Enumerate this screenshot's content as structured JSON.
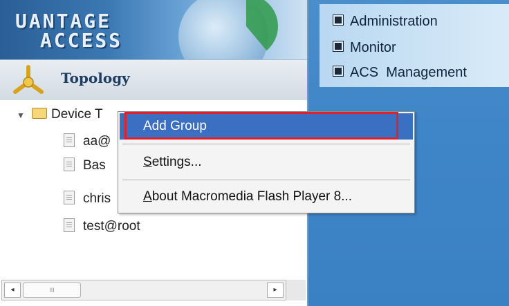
{
  "app": {
    "brand_line1": "UANTAGE",
    "brand_line2": "ACCESS"
  },
  "topology": {
    "title": "Topology"
  },
  "tree": {
    "root_label": "Device T",
    "items": [
      {
        "label": "aa@"
      },
      {
        "label": "Bas"
      },
      {
        "label": "chris"
      },
      {
        "label": "test@root"
      }
    ]
  },
  "scrollbar": {
    "left_arrow": "◂",
    "right_arrow": "▸",
    "thumb_grip": "III"
  },
  "nav": {
    "items": [
      {
        "label": "Administration"
      },
      {
        "label": "Monitor"
      },
      {
        "label": "ACS  Management"
      }
    ]
  },
  "context_menu": {
    "items": [
      {
        "label": "Add Group",
        "selected": true
      },
      {
        "label_prefix": "",
        "label_mnemonic": "S",
        "label_rest": "ettings...",
        "label": "Settings..."
      },
      {
        "label_mnemonic": "A",
        "label_rest": "bout Macromedia Flash Player 8...",
        "label": "About Macromedia Flash Player 8..."
      }
    ]
  },
  "colors": {
    "selection": "#3a6fc2",
    "highlight_border": "#e0202a",
    "right_bg": "#3f86c8",
    "title": "#1e3d63"
  }
}
